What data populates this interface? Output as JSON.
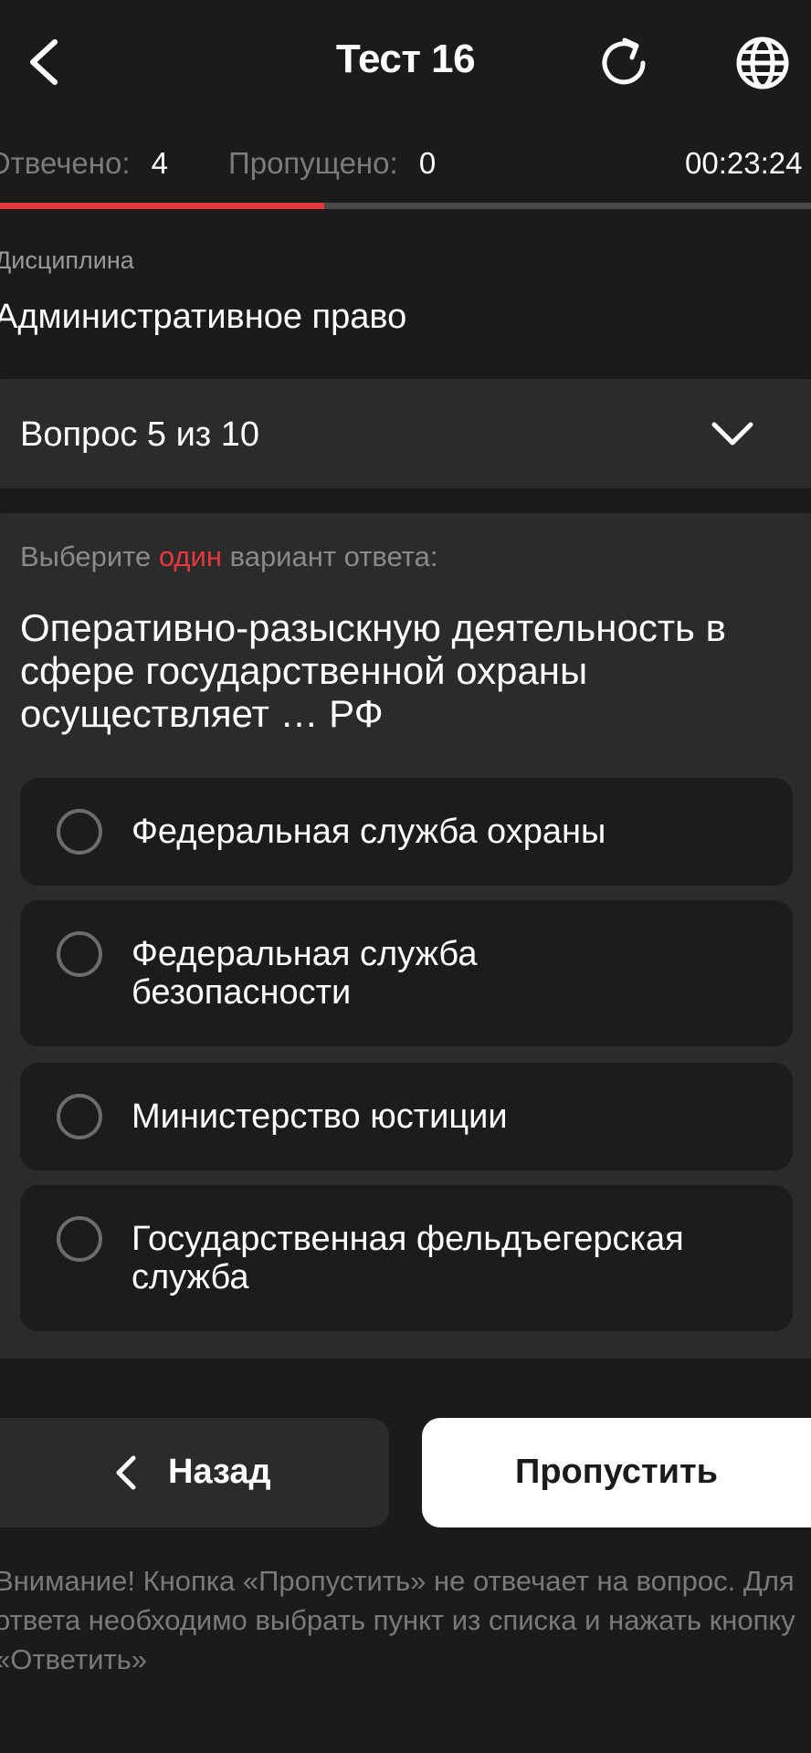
{
  "header": {
    "title": "Тест 16"
  },
  "stats": {
    "answered_label": "Отвечено:",
    "answered_value": "4",
    "skipped_label": "Пропущено:",
    "skipped_value": "0",
    "timer": "00:23:24"
  },
  "progress": {
    "fraction": 0.4,
    "fill_color": "#e9373e",
    "track_color": "#4a4a4a"
  },
  "discipline": {
    "label": "Дисциплина",
    "value": "Административное право"
  },
  "question_selector": {
    "label": "Вопрос 5 из 10"
  },
  "question": {
    "instruction_before": "Выберите ",
    "instruction_accent": "один",
    "instruction_after": " вариант ответа:",
    "text": "Оперативно-разыскную деятельность в сфере государственной охраны осуществляет … РФ",
    "options": [
      "Федеральная служба охраны",
      "Федеральная служба безопасности",
      "Министерство юстиции",
      "Государственная фельдъегерская служба"
    ]
  },
  "buttons": {
    "back_label": "Назад",
    "skip_label": "Пропустить"
  },
  "warning": "Внимание! Кнопка «Пропустить» не отвечает на вопрос. Для ответа необходимо выбрать пункт из списка и нажать кнопку «Ответить»",
  "colors": {
    "background": "#1b1b1b",
    "card": "#2b2b2b",
    "accent": "#e9373e"
  }
}
